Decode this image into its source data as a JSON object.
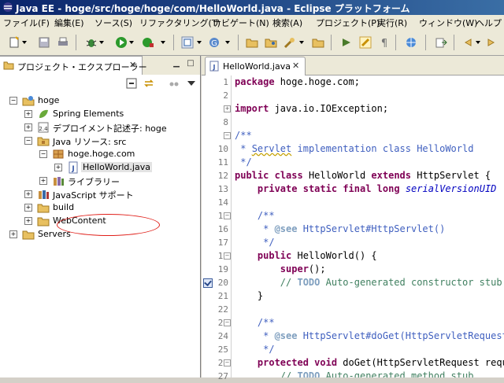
{
  "window": {
    "title": "Java EE - hoge/src/hoge/hoge/com/HelloWorld.java - Eclipse プラットフォーム"
  },
  "menu": [
    "ファイル(F)",
    "編集(E)",
    "ソース(S)",
    "リファクタリング(T)",
    "ナビゲート(N)",
    "検索(A)",
    "プロジェクト(P)",
    "実行(R)",
    "ウィンドウ(W)",
    "ヘルプ"
  ],
  "explorer": {
    "tab_label": "プロジェクト・エクスプローラー",
    "close_glyph": "✕",
    "tree": [
      {
        "label": "hoge",
        "expander": "−"
      },
      {
        "label": "Spring Elements",
        "expander": "+"
      },
      {
        "label": "デプロイメント記述子: hoge",
        "expander": "+"
      },
      {
        "label": "Java リソース: src",
        "expander": "−"
      },
      {
        "label": "hoge.hoge.com",
        "expander": "−"
      },
      {
        "label": "HelloWorld.java",
        "expander": "+"
      },
      {
        "label": "ライブラリー",
        "expander": "+"
      },
      {
        "label": "JavaScript サポート",
        "expander": "+"
      },
      {
        "label": "build",
        "expander": "+"
      },
      {
        "label": "WebContent",
        "expander": "+"
      },
      {
        "label": "Servers",
        "expander": "+"
      }
    ]
  },
  "editor": {
    "tab_label": "HelloWorld.java",
    "close_glyph": "✕",
    "lines": [
      {
        "num": "1",
        "tokens": [
          {
            "t": "package",
            "c": "kw"
          },
          {
            "t": " hoge.hoge.com;"
          }
        ]
      },
      {
        "num": "2",
        "tokens": []
      },
      {
        "num": "3",
        "tokens": [
          {
            "t": "import",
            "c": "kw"
          },
          {
            "t": " java.io.IOException;"
          }
        ],
        "fold": "+"
      },
      {
        "num": "8",
        "tokens": []
      },
      {
        "num": "9",
        "tokens": [
          {
            "t": "/**",
            "c": "cm"
          }
        ],
        "fold": "−"
      },
      {
        "num": "10",
        "tokens": [
          {
            "t": " * ",
            "c": "cm"
          },
          {
            "t": "Servlet",
            "c": "cm sq"
          },
          {
            "t": " implementation class HelloWorld",
            "c": "cm"
          }
        ]
      },
      {
        "num": "11",
        "tokens": [
          {
            "t": " */",
            "c": "cm"
          }
        ]
      },
      {
        "num": "12",
        "tokens": [
          {
            "t": "public",
            "c": "kw"
          },
          {
            "t": " "
          },
          {
            "t": "class",
            "c": "kw"
          },
          {
            "t": " HelloWorld "
          },
          {
            "t": "extends",
            "c": "kw"
          },
          {
            "t": " HttpServlet {"
          }
        ]
      },
      {
        "num": "13",
        "tokens": [
          {
            "t": "    "
          },
          {
            "t": "private",
            "c": "kw"
          },
          {
            "t": " "
          },
          {
            "t": "static",
            "c": "kw"
          },
          {
            "t": " "
          },
          {
            "t": "final",
            "c": "kw"
          },
          {
            "t": " "
          },
          {
            "t": "long",
            "c": "kw"
          },
          {
            "t": " "
          },
          {
            "t": "serialVersionUID",
            "c": "it"
          }
        ]
      },
      {
        "num": "14",
        "tokens": []
      },
      {
        "num": "15",
        "tokens": [
          {
            "t": "    /**",
            "c": "cm"
          }
        ],
        "fold": "−"
      },
      {
        "num": "16",
        "tokens": [
          {
            "t": "     * ",
            "c": "cm"
          },
          {
            "t": "@see",
            "c": "tg"
          },
          {
            "t": " HttpServlet#HttpServlet()",
            "c": "cm"
          }
        ]
      },
      {
        "num": "17",
        "tokens": [
          {
            "t": "     */",
            "c": "cm"
          }
        ]
      },
      {
        "num": "18",
        "tokens": [
          {
            "t": "    "
          },
          {
            "t": "public",
            "c": "kw"
          },
          {
            "t": " HelloWorld() {"
          }
        ],
        "fold": "−"
      },
      {
        "num": "19",
        "tokens": [
          {
            "t": "        "
          },
          {
            "t": "super",
            "c": "kw"
          },
          {
            "t": "();"
          }
        ]
      },
      {
        "num": "20",
        "tokens": [
          {
            "t": "        // ",
            "c": "lc"
          },
          {
            "t": "TODO",
            "c": "tg"
          },
          {
            "t": " Auto-generated constructor stub",
            "c": "lc"
          }
        ],
        "task": true
      },
      {
        "num": "21",
        "tokens": [
          {
            "t": "    }"
          }
        ]
      },
      {
        "num": "22",
        "tokens": []
      },
      {
        "num": "23",
        "tokens": [
          {
            "t": "    /**",
            "c": "cm"
          }
        ],
        "fold": "−"
      },
      {
        "num": "24",
        "tokens": [
          {
            "t": "     * ",
            "c": "cm"
          },
          {
            "t": "@see",
            "c": "tg"
          },
          {
            "t": " HttpServlet#doGet(HttpServletRequest",
            "c": "cm"
          }
        ]
      },
      {
        "num": "25",
        "tokens": [
          {
            "t": "     */",
            "c": "cm"
          }
        ]
      },
      {
        "num": "26",
        "tokens": [
          {
            "t": "    "
          },
          {
            "t": "protected",
            "c": "kw"
          },
          {
            "t": " "
          },
          {
            "t": "void",
            "c": "kw"
          },
          {
            "t": " doGet(HttpServletRequest request"
          }
        ],
        "fold": "−"
      },
      {
        "num": "27",
        "tokens": [
          {
            "t": "        // ",
            "c": "lc"
          },
          {
            "t": "TODO",
            "c": "tg"
          },
          {
            "t": " Auto-generated method stub",
            "c": "lc"
          }
        ]
      }
    ]
  }
}
